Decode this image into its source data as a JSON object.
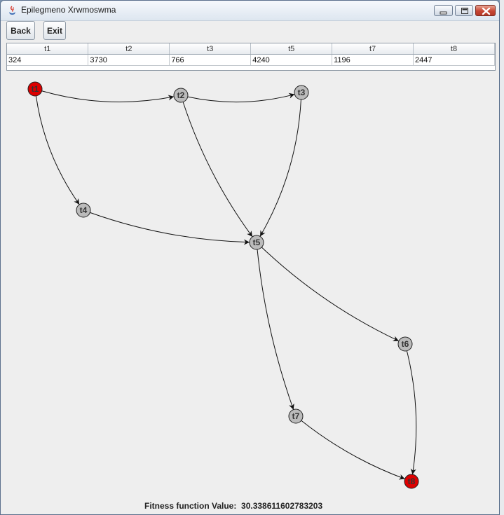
{
  "window": {
    "title": "Epilegmeno Xrwmoswma"
  },
  "toolbar": {
    "back_label": "Back",
    "exit_label": "Exit"
  },
  "table": {
    "headers": [
      "t1",
      "t2",
      "t3",
      "t5",
      "t7",
      "t8"
    ],
    "values": [
      "324",
      "3730",
      "766",
      "4240",
      "1196",
      "2447"
    ]
  },
  "graph": {
    "nodes": [
      {
        "id": "t1",
        "label": "t1",
        "color": "#dd0000"
      },
      {
        "id": "t2",
        "label": "t2",
        "color": "#bbbbbb"
      },
      {
        "id": "t3",
        "label": "t3",
        "color": "#bbbbbb"
      },
      {
        "id": "t4",
        "label": "t4",
        "color": "#bbbbbb"
      },
      {
        "id": "t5",
        "label": "t5",
        "color": "#bbbbbb"
      },
      {
        "id": "t6",
        "label": "t6",
        "color": "#bbbbbb"
      },
      {
        "id": "t7",
        "label": "t7",
        "color": "#bbbbbb"
      },
      {
        "id": "t8",
        "label": "t8",
        "color": "#dd0000"
      }
    ],
    "edges": [
      [
        "t1",
        "t2"
      ],
      [
        "t1",
        "t4"
      ],
      [
        "t2",
        "t3"
      ],
      [
        "t2",
        "t5"
      ],
      [
        "t3",
        "t5"
      ],
      [
        "t4",
        "t5"
      ],
      [
        "t5",
        "t6"
      ],
      [
        "t5",
        "t7"
      ],
      [
        "t6",
        "t8"
      ],
      [
        "t7",
        "t8"
      ]
    ]
  },
  "footer": {
    "fitness_label": "Fitness function Value:",
    "fitness_value": "30.338611602783203"
  }
}
